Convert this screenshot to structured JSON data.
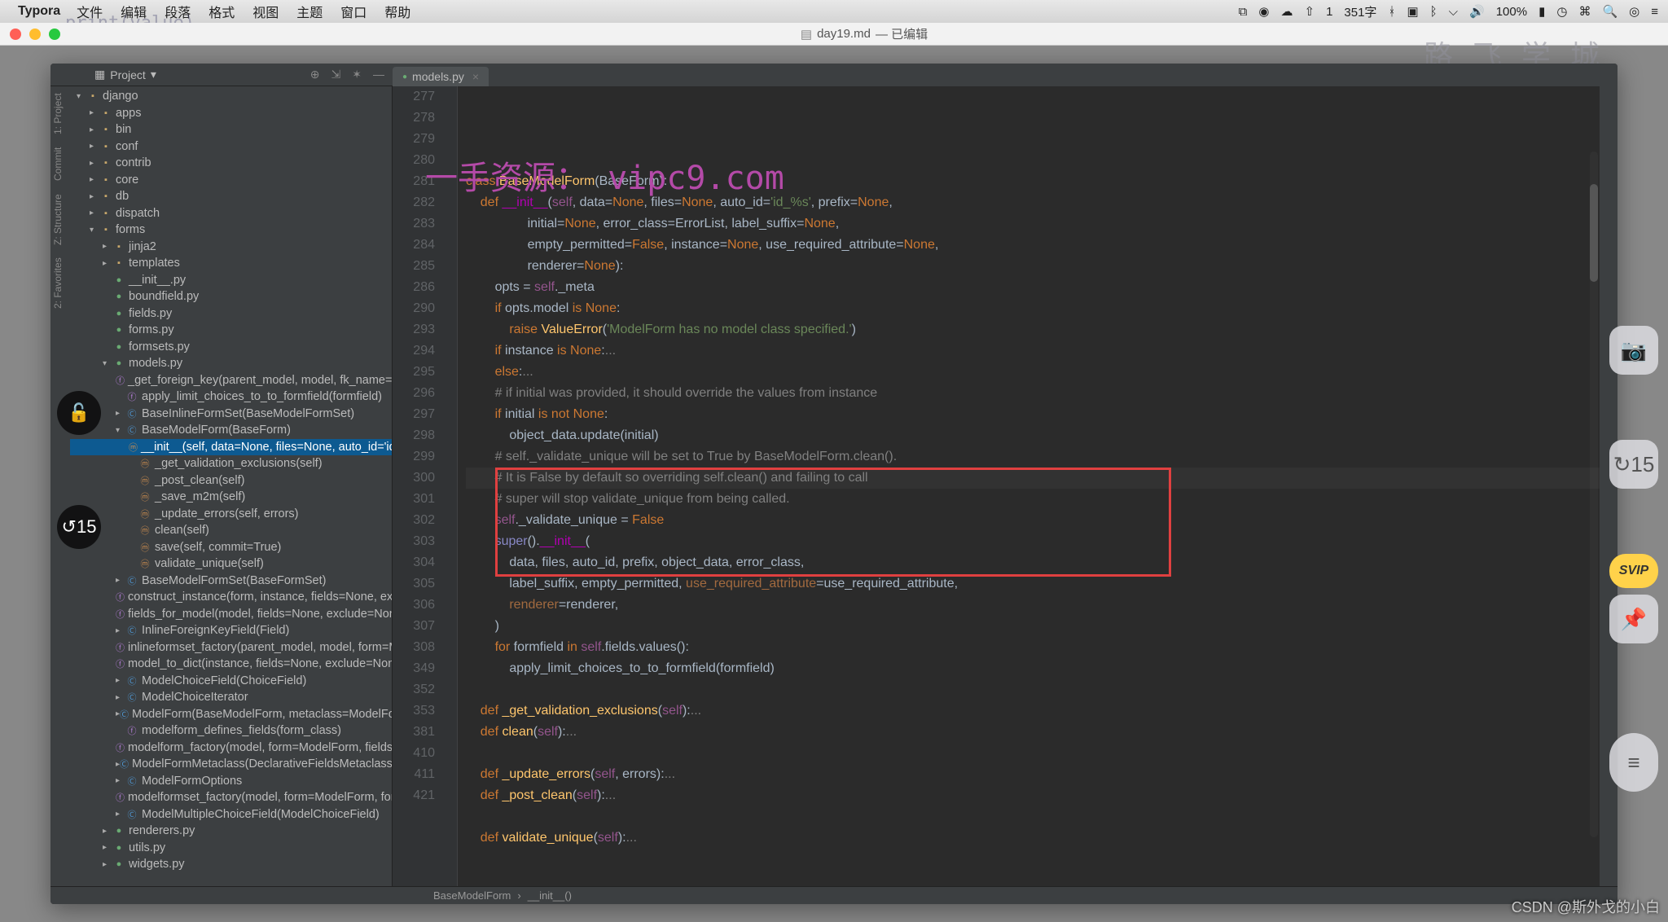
{
  "mac_menu": {
    "app_name": "Typora",
    "items": [
      "文件",
      "编辑",
      "段落",
      "格式",
      "视图",
      "主题",
      "窗口",
      "帮助"
    ],
    "right": {
      "ime": "1",
      "net": "351字",
      "battery": "100%",
      "clock": ""
    }
  },
  "typora": {
    "doc_title": "day19.md",
    "doc_status": "— 已编辑",
    "body_hint": "print(value)",
    "logo_right": "路飞学城"
  },
  "watermark": "一手资源： vipc9.com",
  "ide": {
    "project_label": "Project",
    "tab_file": "models.py",
    "structure_label": "Z: Structure",
    "project_rail": "1: Project",
    "commit_rail": "Commit",
    "favorites_rail": "2: Favorites",
    "breadcrumb": [
      "BaseModelForm",
      "__init__()"
    ]
  },
  "tree": [
    {
      "d": 0,
      "a": "down",
      "i": "folder",
      "t": "django"
    },
    {
      "d": 1,
      "a": "right",
      "i": "folder",
      "t": "apps"
    },
    {
      "d": 1,
      "a": "right",
      "i": "folder",
      "t": "bin"
    },
    {
      "d": 1,
      "a": "right",
      "i": "folder",
      "t": "conf"
    },
    {
      "d": 1,
      "a": "right",
      "i": "folder",
      "t": "contrib"
    },
    {
      "d": 1,
      "a": "right",
      "i": "folder",
      "t": "core"
    },
    {
      "d": 1,
      "a": "right",
      "i": "folder",
      "t": "db"
    },
    {
      "d": 1,
      "a": "right",
      "i": "folder",
      "t": "dispatch"
    },
    {
      "d": 1,
      "a": "down",
      "i": "folder",
      "t": "forms"
    },
    {
      "d": 2,
      "a": "right",
      "i": "folder",
      "t": "jinja2"
    },
    {
      "d": 2,
      "a": "right",
      "i": "folder",
      "t": "templates"
    },
    {
      "d": 2,
      "a": "",
      "i": "py",
      "t": "__init__.py"
    },
    {
      "d": 2,
      "a": "",
      "i": "py",
      "t": "boundfield.py"
    },
    {
      "d": 2,
      "a": "",
      "i": "py",
      "t": "fields.py"
    },
    {
      "d": 2,
      "a": "",
      "i": "py",
      "t": "forms.py"
    },
    {
      "d": 2,
      "a": "",
      "i": "py",
      "t": "formsets.py"
    },
    {
      "d": 2,
      "a": "down",
      "i": "py",
      "t": "models.py"
    },
    {
      "d": 3,
      "a": "",
      "i": "func",
      "t": "_get_foreign_key(parent_model, model, fk_name=Nor"
    },
    {
      "d": 3,
      "a": "",
      "i": "func",
      "t": "apply_limit_choices_to_to_formfield(formfield)"
    },
    {
      "d": 3,
      "a": "right",
      "i": "class",
      "t": "BaseInlineFormSet(BaseModelFormSet)"
    },
    {
      "d": 3,
      "a": "down",
      "i": "class",
      "t": "BaseModelForm(BaseForm)"
    },
    {
      "d": 4,
      "a": "",
      "i": "method",
      "t": "__init__(self, data=None, files=None, auto_id='id_%",
      "sel": true
    },
    {
      "d": 4,
      "a": "",
      "i": "method",
      "t": "_get_validation_exclusions(self)"
    },
    {
      "d": 4,
      "a": "",
      "i": "method",
      "t": "_post_clean(self)"
    },
    {
      "d": 4,
      "a": "",
      "i": "method",
      "t": "_save_m2m(self)"
    },
    {
      "d": 4,
      "a": "",
      "i": "method",
      "t": "_update_errors(self, errors)"
    },
    {
      "d": 4,
      "a": "",
      "i": "method",
      "t": "clean(self)"
    },
    {
      "d": 4,
      "a": "",
      "i": "method",
      "t": "save(self, commit=True)"
    },
    {
      "d": 4,
      "a": "",
      "i": "method",
      "t": "validate_unique(self)"
    },
    {
      "d": 3,
      "a": "right",
      "i": "class",
      "t": "BaseModelFormSet(BaseFormSet)"
    },
    {
      "d": 3,
      "a": "",
      "i": "func",
      "t": "construct_instance(form, instance, fields=None, excl"
    },
    {
      "d": 3,
      "a": "",
      "i": "func",
      "t": "fields_for_model(model, fields=None, exclude=None,"
    },
    {
      "d": 3,
      "a": "right",
      "i": "class",
      "t": "InlineForeignKeyField(Field)"
    },
    {
      "d": 3,
      "a": "",
      "i": "func",
      "t": "inlineformset_factory(parent_model, model, form=Mo"
    },
    {
      "d": 3,
      "a": "",
      "i": "func",
      "t": "model_to_dict(instance, fields=None, exclude=None)"
    },
    {
      "d": 3,
      "a": "right",
      "i": "class",
      "t": "ModelChoiceField(ChoiceField)"
    },
    {
      "d": 3,
      "a": "right",
      "i": "class",
      "t": "ModelChoiceIterator"
    },
    {
      "d": 3,
      "a": "right",
      "i": "class",
      "t": "ModelForm(BaseModelForm, metaclass=ModelFormMe"
    },
    {
      "d": 3,
      "a": "",
      "i": "func",
      "t": "modelform_defines_fields(form_class)"
    },
    {
      "d": 3,
      "a": "",
      "i": "func",
      "t": "modelform_factory(model, form=ModelForm, fields=N"
    },
    {
      "d": 3,
      "a": "right",
      "i": "class",
      "t": "ModelFormMetaclass(DeclarativeFieldsMetaclass)"
    },
    {
      "d": 3,
      "a": "right",
      "i": "class",
      "t": "ModelFormOptions"
    },
    {
      "d": 3,
      "a": "",
      "i": "func",
      "t": "modelformset_factory(model, form=ModelForm, form"
    },
    {
      "d": 3,
      "a": "right",
      "i": "class",
      "t": "ModelMultipleChoiceField(ModelChoiceField)"
    },
    {
      "d": 2,
      "a": "right",
      "i": "py",
      "t": "renderers.py"
    },
    {
      "d": 2,
      "a": "right",
      "i": "py",
      "t": "utils.py"
    },
    {
      "d": 2,
      "a": "right",
      "i": "py",
      "t": "widgets.py"
    }
  ],
  "code": {
    "line_numbers": [
      "277",
      "278",
      "279",
      "280",
      "281",
      "282",
      "283",
      "284",
      "285",
      "286",
      "290",
      "293",
      "294",
      "295",
      "296",
      "297",
      "298",
      "299",
      "300",
      "301",
      "302",
      "303",
      "304",
      "305",
      "306",
      "307",
      "308",
      "349",
      "352",
      "353",
      "381",
      "410",
      "411",
      "421"
    ],
    "lines": [
      {
        "n": "277",
        "html": ""
      },
      {
        "n": "278",
        "html": "<span class='kw'>class</span> <span class='fn'>BaseModelForm</span>(BaseForm):"
      },
      {
        "n": "279",
        "html": "    <span class='kw'>def</span> <span class='dunder'>__init__</span>(<span class='self'>self</span>, data=<span class='kw'>None</span>, files=<span class='kw'>None</span>, auto_id=<span class='str'>'id_%s'</span>, prefix=<span class='kw'>None</span>,"
      },
      {
        "n": "280",
        "html": "                 initial=<span class='kw'>None</span>, error_class=ErrorList, label_suffix=<span class='kw'>None</span>,"
      },
      {
        "n": "281",
        "html": "                 empty_permitted=<span class='kw'>False</span>, instance=<span class='kw'>None</span>, use_required_attribute=<span class='kw'>None</span>,"
      },
      {
        "n": "282",
        "html": "                 renderer=<span class='kw'>None</span>):"
      },
      {
        "n": "283",
        "html": "        opts = <span class='self'>self</span>._meta"
      },
      {
        "n": "284",
        "html": "        <span class='kw'>if</span> opts.model <span class='kw'>is None</span>:"
      },
      {
        "n": "285",
        "html": "            <span class='kw'>raise</span> <span class='fn'>ValueError</span>(<span class='str'>'ModelForm has no model class specified.'</span>)"
      },
      {
        "n": "286",
        "html": "        <span class='kw'>if</span> instance <span class='kw'>is None</span>:<span class='cmt'>...</span>"
      },
      {
        "n": "290",
        "html": "        <span class='kw'>else</span>:<span class='cmt'>...</span>"
      },
      {
        "n": "293",
        "html": "        <span class='cmt'># if initial was provided, it should override the values from instance</span>"
      },
      {
        "n": "294",
        "html": "        <span class='kw'>if</span> initial <span class='kw'>is not None</span>:"
      },
      {
        "n": "295",
        "html": "            object_data.update(initial)"
      },
      {
        "n": "296",
        "html": "        <span class='cmt'># self._validate_unique will be set to True by BaseModelForm.clean().</span>"
      },
      {
        "n": "297",
        "html": "        <span class='cmt'># It is False by default so overriding self.clean() and failing to call</span>",
        "cursor": true
      },
      {
        "n": "298",
        "html": "        <span class='cmt'># super will stop validate_unique from being called.</span>"
      },
      {
        "n": "299",
        "html": "        <span class='self'>self</span>._validate_unique = <span class='kw'>False</span>"
      },
      {
        "n": "300",
        "html": "        <span class='builtin'>super</span>().<span class='dunder'>__init__</span>("
      },
      {
        "n": "301",
        "html": "            data, files, auto_id, prefix, object_data, error_class,"
      },
      {
        "n": "302",
        "html": "            label_suffix, empty_permitted, <span class='param' style='color:#a26a3f'>use_required_attribute</span>=use_required_attribute,"
      },
      {
        "n": "303",
        "html": "            <span class='param' style='color:#a26a3f'>renderer</span>=renderer,"
      },
      {
        "n": "304",
        "html": "        )"
      },
      {
        "n": "305",
        "html": "        <span class='kw'>for</span> formfield <span class='kw'>in</span> <span class='self'>self</span>.fields.values():"
      },
      {
        "n": "306",
        "html": "            apply_limit_choices_to_to_formfield(formfield)"
      },
      {
        "n": "307",
        "html": ""
      },
      {
        "n": "308",
        "html": "    <span class='kw'>def</span> <span class='fn'>_get_validation_exclusions</span>(<span class='self'>self</span>):<span class='cmt'>...</span>"
      },
      {
        "n": "349",
        "html": "    <span class='kw'>def</span> <span class='fn'>clean</span>(<span class='self'>self</span>):<span class='cmt'>...</span>"
      },
      {
        "n": "352",
        "html": ""
      },
      {
        "n": "353",
        "html": "    <span class='kw'>def</span> <span class='fn'>_update_errors</span>(<span class='self'>self</span>, errors):<span class='cmt'>...</span>"
      },
      {
        "n": "381",
        "html": "    <span class='kw'>def</span> <span class='fn'>_post_clean</span>(<span class='self'>self</span>):<span class='cmt'>...</span>"
      },
      {
        "n": "410",
        "html": ""
      },
      {
        "n": "411",
        "html": "    <span class='kw'>def</span> <span class='fn'>validate_unique</span>(<span class='self'>self</span>):<span class='cmt'>...</span>"
      },
      {
        "n": "421",
        "html": ""
      }
    ]
  },
  "csdn": "CSDN @斯外戈的小白"
}
